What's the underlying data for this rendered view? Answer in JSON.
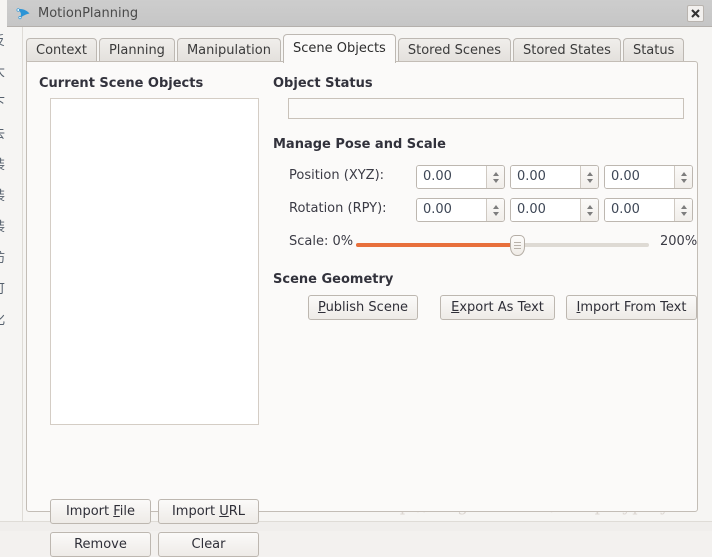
{
  "window": {
    "title": "MotionPlanning",
    "icon": "motion-planning-icon",
    "close_label": "✖"
  },
  "tabs": [
    {
      "label": "Context",
      "active": false
    },
    {
      "label": "Planning",
      "active": false
    },
    {
      "label": "Manipulation",
      "active": false
    },
    {
      "label": "Scene Objects",
      "active": true
    },
    {
      "label": "Stored Scenes",
      "active": false
    },
    {
      "label": "Stored States",
      "active": false
    },
    {
      "label": "Status",
      "active": false
    }
  ],
  "left_panel": {
    "title": "Current Scene Objects",
    "list_items": [],
    "buttons": {
      "import_file": {
        "pre": "Import ",
        "mnemonic": "F",
        "post": "ile"
      },
      "import_url": {
        "pre": "Import ",
        "mnemonic": "U",
        "post": "RL"
      },
      "remove": {
        "pre": "Remove",
        "mnemonic": "",
        "post": ""
      },
      "clear": {
        "pre": "Clear",
        "mnemonic": "",
        "post": ""
      }
    }
  },
  "right_panel": {
    "object_status": {
      "title": "Object Status",
      "value": "",
      "placeholder": ""
    },
    "manage_pose": {
      "title": "Manage Pose and Scale",
      "position_label": "Position (XYZ):",
      "position_values": [
        "0.00",
        "0.00",
        "0.00"
      ],
      "rotation_label": "Rotation (RPY):",
      "rotation_values": [
        "0.00",
        "0.00",
        "0.00"
      ],
      "scale_label": "Scale:",
      "scale_min_label": "0%",
      "scale_max_label": "200%",
      "scale_value_percent": 55
    },
    "scene_geometry": {
      "title": "Scene Geometry",
      "buttons": {
        "publish_scene": {
          "pre": "",
          "mnemonic": "P",
          "post": "ublish Scene"
        },
        "export_as_text": {
          "pre": "",
          "mnemonic": "E",
          "post": "xport As Text"
        },
        "import_from_text": {
          "pre": "",
          "mnemonic": "I",
          "post": "mport From Text"
        }
      }
    }
  },
  "backdrop": {
    "side_text": [
      "反",
      "大",
      "下",
      "去",
      "装",
      "装",
      "装",
      "防",
      "",
      "可",
      "化"
    ],
    "watermark": "http://blog.csdn.net/coldplayplay"
  },
  "colors": {
    "accent_orange": "#e8703c",
    "titlebar": "#c8c8c8",
    "panel_bg": "#fbfaf9",
    "border": "#c3bdb6"
  }
}
